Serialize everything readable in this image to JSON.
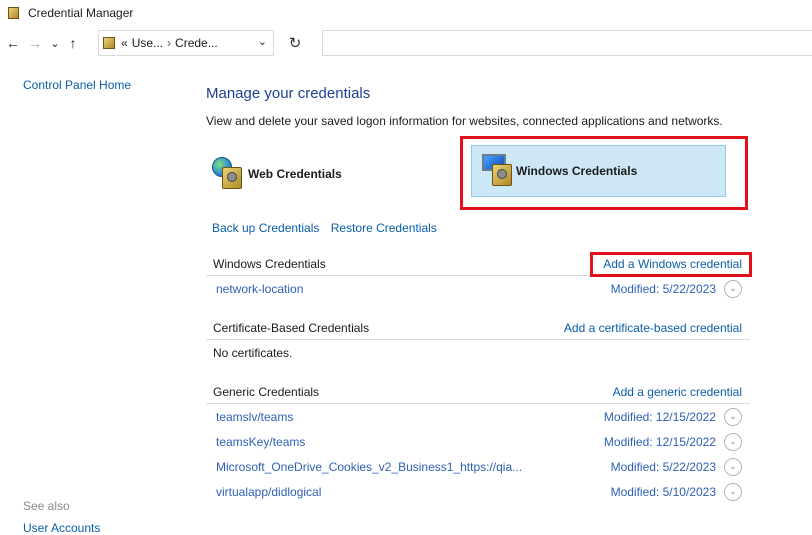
{
  "window": {
    "title": "Credential Manager"
  },
  "nav": {
    "back": "←",
    "forward": "→",
    "recent": "⌄",
    "up": "↑",
    "breadcrumb": [
      "«",
      "Use...",
      "Crede..."
    ],
    "breadcrumb_sep": "›",
    "dropdown": "⌄",
    "refresh": "↻"
  },
  "sidebar": {
    "home": "Control Panel Home",
    "see_also": "See also",
    "user_accounts": "User Accounts"
  },
  "main": {
    "heading": "Manage your credentials",
    "description": "View and delete your saved logon information for websites, connected applications and networks.",
    "web_credentials": "Web Credentials",
    "windows_credentials": "Windows Credentials",
    "backup": "Back up Credentials",
    "restore": "Restore Credentials"
  },
  "sections": {
    "windows": {
      "title": "Windows Credentials",
      "add": "Add a Windows credential",
      "items": [
        {
          "name": "network-location",
          "modified": "Modified:  5/22/2023"
        }
      ]
    },
    "certificate": {
      "title": "Certificate-Based Credentials",
      "add": "Add a certificate-based credential",
      "empty": "No certificates."
    },
    "generic": {
      "title": "Generic Credentials",
      "add": "Add a generic credential",
      "items": [
        {
          "name": "teamslv/teams",
          "modified": "Modified:  12/15/2022"
        },
        {
          "name": "teamsKey/teams",
          "modified": "Modified:  12/15/2022"
        },
        {
          "name": "Microsoft_OneDrive_Cookies_v2_Business1_https://qia...",
          "modified": "Modified:  5/22/2023"
        },
        {
          "name": "virtualapp/didlogical",
          "modified": "Modified:  5/10/2023"
        }
      ]
    }
  },
  "colors": {
    "highlight": "#e0111b",
    "selected_bg": "#cce8f7",
    "link": "#0a5ea8"
  },
  "icons": {
    "expand": "chevron-down-icon"
  }
}
